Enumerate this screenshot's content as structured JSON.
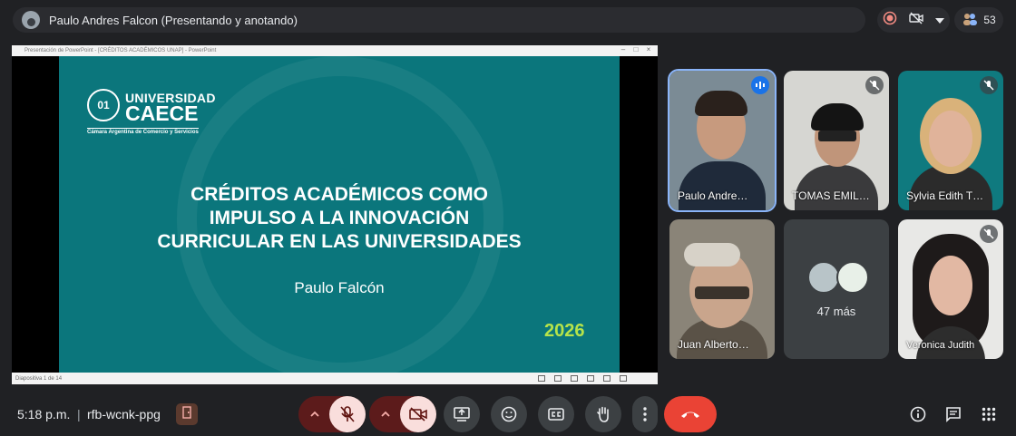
{
  "header": {
    "presenter_label": "Paulo Andres Falcon (Presentando y anotando)",
    "participant_count": "53"
  },
  "slide_window": {
    "title_bar": "Presentación de PowerPoint - [CRÉDITOS ACADÉMICOS UNAP] - PowerPoint",
    "status": "Diapositiva 1 de 14"
  },
  "slide": {
    "logo_universidad": "UNIVERSIDAD",
    "logo_caece": "CAECE",
    "logo_seal": "01",
    "logo_subtitle": "Cámara Argentina de Comercio y Servicios",
    "title_lines": [
      "CRÉDITOS ACADÉMICOS COMO",
      "IMPULSO A LA INNOVACIÓN",
      "CURRICULAR EN LAS UNIVERSIDADES"
    ],
    "author": "Paulo Falcón",
    "year": "2026"
  },
  "participants": [
    {
      "name": "Paulo Andre…",
      "status": "speaking"
    },
    {
      "name": "TOMAS EMIL…",
      "status": "muted"
    },
    {
      "name": "Sylvia Edith T…",
      "status": "muted"
    },
    {
      "name": "Juan Alberto…",
      "status": ""
    },
    {
      "name": "47 más",
      "status": ""
    },
    {
      "name": "Veronica Judith",
      "status": "muted"
    }
  ],
  "footer": {
    "time": "5:18 p.m.",
    "separator": "|",
    "meeting_code": "rfb-wcnk-ppg"
  },
  "colors": {
    "background": "#202124",
    "slide_teal": "#0b767c",
    "end_call": "#ea4335",
    "muted_bg": "#f9dedc",
    "year_green": "#b6e34a"
  }
}
